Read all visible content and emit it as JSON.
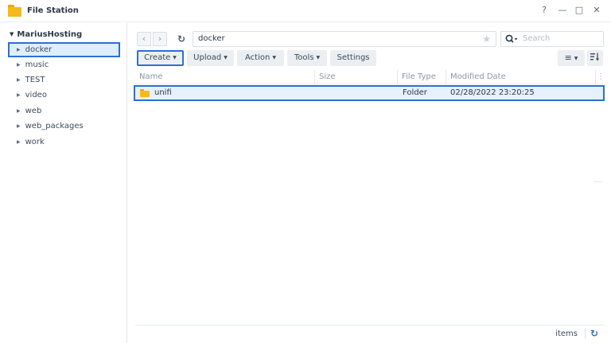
{
  "window": {
    "title": "File Station",
    "help_label": "?",
    "minimize_label": "—",
    "maximize_label": "□",
    "close_label": "✕"
  },
  "sidebar": {
    "root_label": "MariusHosting",
    "items": [
      {
        "label": "docker",
        "selected": true
      },
      {
        "label": "music"
      },
      {
        "label": "TEST"
      },
      {
        "label": "video"
      },
      {
        "label": "web"
      },
      {
        "label": "web_packages"
      },
      {
        "label": "work"
      }
    ]
  },
  "navigation": {
    "back_icon": "chevron-left-icon",
    "forward_icon": "chevron-right-icon",
    "refresh_icon": "refresh-icon",
    "path": "docker",
    "favorite_icon": "star-icon"
  },
  "search": {
    "placeholder": "Search"
  },
  "toolbar": {
    "create_label": "Create",
    "upload_label": "Upload",
    "action_label": "Action",
    "tools_label": "Tools",
    "settings_label": "Settings"
  },
  "table": {
    "columns": [
      "Name",
      "Size",
      "File Type",
      "Modified Date"
    ],
    "rows": [
      {
        "name": "unifi",
        "size": "",
        "type": "Folder",
        "modified": "02/28/2022 23:20:25"
      }
    ]
  },
  "footer": {
    "items_label": "items"
  },
  "colors": {
    "accent": "#2b6fd6",
    "folder": "#f6b91a",
    "selection_bg": "#dfeefc"
  }
}
